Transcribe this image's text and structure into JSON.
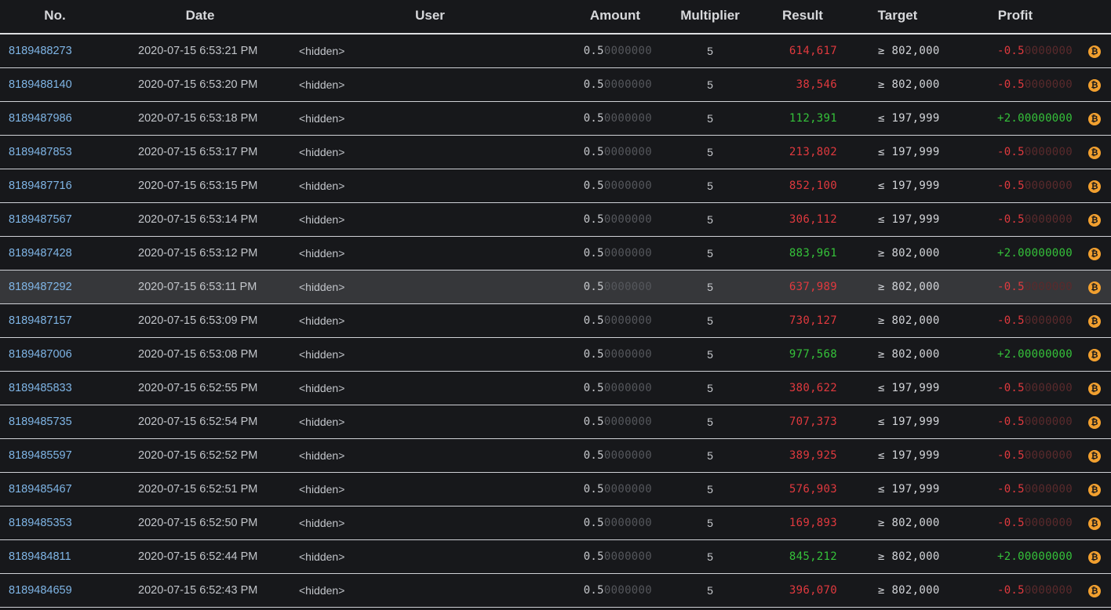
{
  "columns": [
    {
      "key": "no",
      "label": "No."
    },
    {
      "key": "date",
      "label": "Date"
    },
    {
      "key": "user",
      "label": "User"
    },
    {
      "key": "amount",
      "label": "Amount"
    },
    {
      "key": "multiplier",
      "label": "Multiplier"
    },
    {
      "key": "result",
      "label": "Result"
    },
    {
      "key": "target",
      "label": "Target"
    },
    {
      "key": "profit",
      "label": "Profit"
    }
  ],
  "colors": {
    "win": "#35c23a",
    "loss": "#e0393e",
    "link": "#7fb5e6",
    "coin": "#f2a02f"
  },
  "coin_icon": "bitcoin-icon",
  "rows": [
    {
      "no": "8189488273",
      "date": "2020-07-15 6:53:21 PM",
      "user": "<hidden>",
      "amount": "0.50000000",
      "multiplier": "5",
      "result": "614,617",
      "target": "≥ 802,000",
      "profit": "-0.50000000",
      "win": false
    },
    {
      "no": "8189488140",
      "date": "2020-07-15 6:53:20 PM",
      "user": "<hidden>",
      "amount": "0.50000000",
      "multiplier": "5",
      "result": "38,546",
      "target": "≥ 802,000",
      "profit": "-0.50000000",
      "win": false
    },
    {
      "no": "8189487986",
      "date": "2020-07-15 6:53:18 PM",
      "user": "<hidden>",
      "amount": "0.50000000",
      "multiplier": "5",
      "result": "112,391",
      "target": "≤ 197,999",
      "profit": "+2.00000000",
      "win": true
    },
    {
      "no": "8189487853",
      "date": "2020-07-15 6:53:17 PM",
      "user": "<hidden>",
      "amount": "0.50000000",
      "multiplier": "5",
      "result": "213,802",
      "target": "≤ 197,999",
      "profit": "-0.50000000",
      "win": false
    },
    {
      "no": "8189487716",
      "date": "2020-07-15 6:53:15 PM",
      "user": "<hidden>",
      "amount": "0.50000000",
      "multiplier": "5",
      "result": "852,100",
      "target": "≤ 197,999",
      "profit": "-0.50000000",
      "win": false
    },
    {
      "no": "8189487567",
      "date": "2020-07-15 6:53:14 PM",
      "user": "<hidden>",
      "amount": "0.50000000",
      "multiplier": "5",
      "result": "306,112",
      "target": "≤ 197,999",
      "profit": "-0.50000000",
      "win": false
    },
    {
      "no": "8189487428",
      "date": "2020-07-15 6:53:12 PM",
      "user": "<hidden>",
      "amount": "0.50000000",
      "multiplier": "5",
      "result": "883,961",
      "target": "≥ 802,000",
      "profit": "+2.00000000",
      "win": true
    },
    {
      "no": "8189487292",
      "date": "2020-07-15 6:53:11 PM",
      "user": "<hidden>",
      "amount": "0.50000000",
      "multiplier": "5",
      "result": "637,989",
      "target": "≥ 802,000",
      "profit": "-0.50000000",
      "win": false,
      "highlight": true
    },
    {
      "no": "8189487157",
      "date": "2020-07-15 6:53:09 PM",
      "user": "<hidden>",
      "amount": "0.50000000",
      "multiplier": "5",
      "result": "730,127",
      "target": "≥ 802,000",
      "profit": "-0.50000000",
      "win": false
    },
    {
      "no": "8189487006",
      "date": "2020-07-15 6:53:08 PM",
      "user": "<hidden>",
      "amount": "0.50000000",
      "multiplier": "5",
      "result": "977,568",
      "target": "≥ 802,000",
      "profit": "+2.00000000",
      "win": true
    },
    {
      "no": "8189485833",
      "date": "2020-07-15 6:52:55 PM",
      "user": "<hidden>",
      "amount": "0.50000000",
      "multiplier": "5",
      "result": "380,622",
      "target": "≤ 197,999",
      "profit": "-0.50000000",
      "win": false
    },
    {
      "no": "8189485735",
      "date": "2020-07-15 6:52:54 PM",
      "user": "<hidden>",
      "amount": "0.50000000",
      "multiplier": "5",
      "result": "707,373",
      "target": "≤ 197,999",
      "profit": "-0.50000000",
      "win": false
    },
    {
      "no": "8189485597",
      "date": "2020-07-15 6:52:52 PM",
      "user": "<hidden>",
      "amount": "0.50000000",
      "multiplier": "5",
      "result": "389,925",
      "target": "≤ 197,999",
      "profit": "-0.50000000",
      "win": false
    },
    {
      "no": "8189485467",
      "date": "2020-07-15 6:52:51 PM",
      "user": "<hidden>",
      "amount": "0.50000000",
      "multiplier": "5",
      "result": "576,903",
      "target": "≤ 197,999",
      "profit": "-0.50000000",
      "win": false
    },
    {
      "no": "8189485353",
      "date": "2020-07-15 6:52:50 PM",
      "user": "<hidden>",
      "amount": "0.50000000",
      "multiplier": "5",
      "result": "169,893",
      "target": "≥ 802,000",
      "profit": "-0.50000000",
      "win": false
    },
    {
      "no": "8189484811",
      "date": "2020-07-15 6:52:44 PM",
      "user": "<hidden>",
      "amount": "0.50000000",
      "multiplier": "5",
      "result": "845,212",
      "target": "≥ 802,000",
      "profit": "+2.00000000",
      "win": true
    },
    {
      "no": "8189484659",
      "date": "2020-07-15 6:52:43 PM",
      "user": "<hidden>",
      "amount": "0.50000000",
      "multiplier": "5",
      "result": "396,070",
      "target": "≥ 802,000",
      "profit": "-0.50000000",
      "win": false
    }
  ]
}
